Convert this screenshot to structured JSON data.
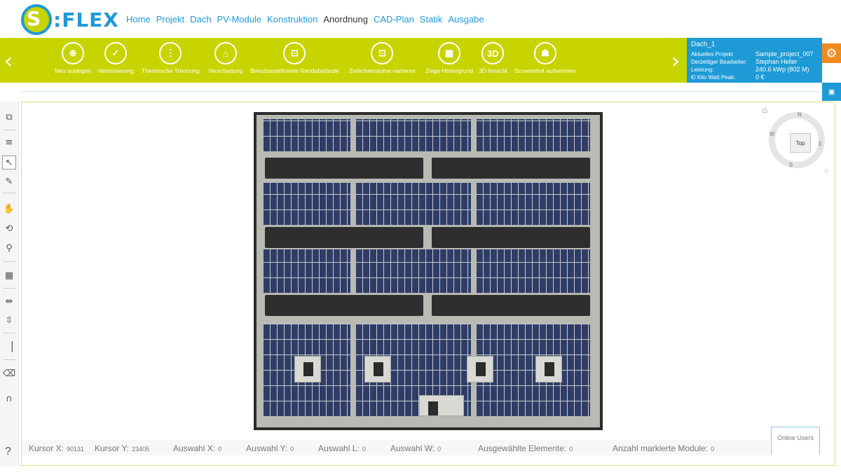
{
  "app": {
    "logo_letter": "S",
    "logo_text": ":FLEX"
  },
  "nav": [
    "Home",
    "Projekt",
    "Dach",
    "PV-Module",
    "Konstruktion",
    "Anordnung",
    "CAD-Plan",
    "Statik",
    "Ausgabe"
  ],
  "nav_active": "Anordnung",
  "toolbar": {
    "prev": "‹",
    "next": "›",
    "tools": [
      {
        "label": "Neu auslegen",
        "icon": "⊕"
      },
      {
        "label": "Versionierung",
        "icon": "✓"
      },
      {
        "label": "Thermische Trennung",
        "icon": "⋮"
      },
      {
        "label": "Verschattung",
        "icon": "⌂"
      },
      {
        "label": "Benutzerdefinierte Randabstände",
        "icon": "⊡"
      },
      {
        "label": "Zwischenräume variieren",
        "icon": "⊡"
      },
      {
        "label": "Zeige Hintergrund",
        "icon": "▦"
      },
      {
        "label": "3D Ansicht",
        "icon": "3D"
      },
      {
        "label": "Screenshot aufnehmen",
        "icon": "☗"
      }
    ]
  },
  "project": {
    "title": "Dach_1",
    "rows": [
      {
        "label": "Aktuelles Projekt",
        "value": "Sample_project_007"
      },
      {
        "label": "Derzeitiger Bearbeiter:",
        "value": "Stephan Heller"
      },
      {
        "label": "Leistung:",
        "value": "240.6 kWp (802 M)"
      },
      {
        "label": "€/ Kilo Watt Peak:",
        "value": "0 €"
      }
    ]
  },
  "compass": {
    "top": "Top",
    "n": "N",
    "e": "E",
    "s": "S",
    "w": "W"
  },
  "status": [
    {
      "label": "Kursor X:",
      "value": "90131"
    },
    {
      "label": "Kursor Y:",
      "value": "23405"
    },
    {
      "label": "Auswahl X:",
      "value": "0"
    },
    {
      "label": "Auswahl Y:",
      "value": "0"
    },
    {
      "label": "Auswahl L:",
      "value": "0"
    },
    {
      "label": "Auswahl W:",
      "value": "0"
    },
    {
      "label": "Ausgewählte Elemente:",
      "value": "0"
    },
    {
      "label": "Anzahl markierte Module:",
      "value": "0"
    }
  ],
  "online_users": "Online Users",
  "help": "?",
  "colors": {
    "accent_green": "#c8d400",
    "accent_blue": "#1e9ad6",
    "accent_orange": "#f08a1c"
  }
}
